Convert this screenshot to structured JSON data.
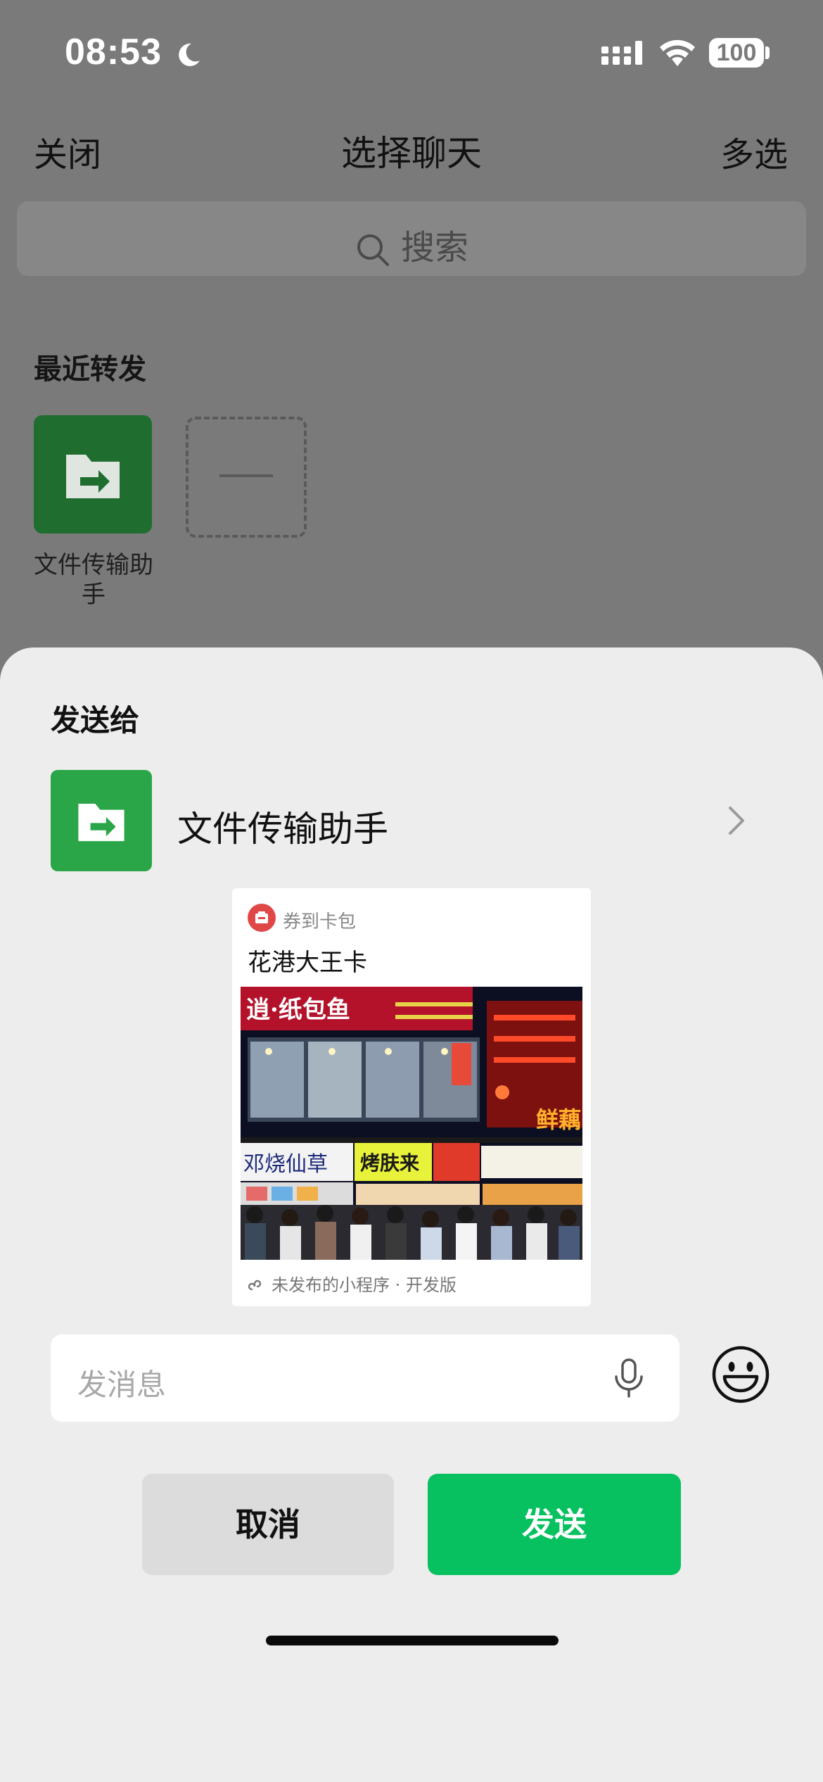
{
  "status_bar": {
    "time": "08:53",
    "battery": "100",
    "icons": [
      "moon-icon",
      "signal-icon",
      "wifi-icon",
      "battery-icon"
    ]
  },
  "nav": {
    "close": "关闭",
    "title": "选择聊天",
    "multi_select": "多选"
  },
  "search": {
    "placeholder": "搜索",
    "icon": "search-icon"
  },
  "recent": {
    "title": "最近转发",
    "items": [
      {
        "label": "文件传输助手",
        "icon": "folder-arrow-icon"
      }
    ]
  },
  "sheet": {
    "send_to": "发送给",
    "target": {
      "name": "文件传输助手",
      "icon": "folder-arrow-icon"
    },
    "card": {
      "app_name": "券到卡包",
      "title": "花港大王卡",
      "footer": "未发布的小程序 · 开发版",
      "photo_signs": [
        "逍·纸包鱼",
        "邓烧仙草",
        "烤肤来",
        "鲜藕"
      ]
    },
    "message": {
      "placeholder": "发消息"
    },
    "buttons": {
      "cancel": "取消",
      "send": "发送"
    }
  },
  "colors": {
    "accent": "#07c160",
    "avatar_green": "#2aa648",
    "overlay": "#7a7a7a",
    "sheet_bg": "#ededed"
  }
}
